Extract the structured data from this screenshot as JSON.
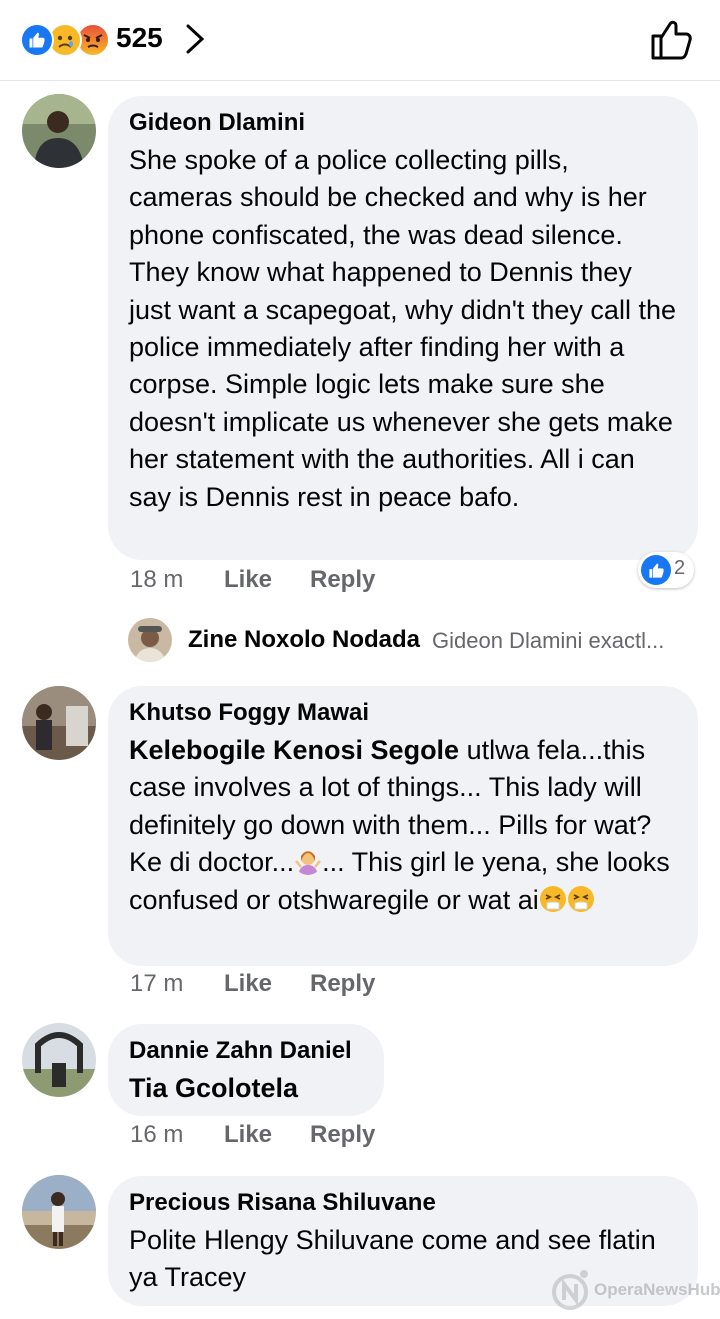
{
  "header": {
    "reaction_count": "525",
    "reactions": [
      "like-icon",
      "sad-icon",
      "angry-icon"
    ]
  },
  "comments": [
    {
      "author": "Gideon Dlamini",
      "text": "She spoke of a police collecting pills, cameras should be checked and why is her phone confiscated, the was dead silence. They know what happened to Dennis they just want a scapegoat, why didn't they call the police immediately after finding her with a corpse. Simple logic lets make sure she doesn't implicate us whenever she gets make her statement with the authorities. All i can say is Dennis rest in peace bafo.",
      "time": "18 m",
      "like_label": "Like",
      "reply_label": "Reply",
      "reaction_count": "2"
    },
    {
      "author": "Khutso Foggy Mawai",
      "mention": "Kelebogile Kenosi Segole",
      "text_part1": " utlwa fela...this case involves a lot of things... This lady will definitely go down with them... Pills for wat? Ke di doctor...",
      "text_part2": "... This girl le yena, she looks confused or otshwaregile or wat ai",
      "time": "17 m",
      "like_label": "Like",
      "reply_label": "Reply"
    },
    {
      "author": "Dannie Zahn Daniel",
      "text": "Tia Gcolotela",
      "time": "16 m",
      "like_label": "Like",
      "reply_label": "Reply"
    },
    {
      "author": "Precious Risana Shiluvane",
      "text": "Polite Hlengy Shiluvane come and see flatin ya Tracey"
    }
  ],
  "reply_preview": {
    "author": "Zine Noxolo Nodada",
    "text": "Gideon Dlamini exactl..."
  },
  "watermark": "OperaNewsHub",
  "colors": {
    "accent": "#1877f2",
    "bubble": "#f0f2f5",
    "meta": "#65676b"
  }
}
